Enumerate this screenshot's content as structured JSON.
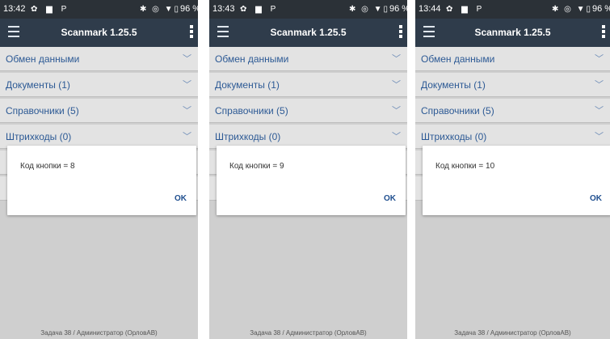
{
  "app_title": "Scanmark 1.25.5",
  "menu_items": [
    "Обмен данными",
    "Документы (1)",
    "Справочники (5)",
    "Штрихкоды (0)"
  ],
  "footer": "Задача 38 / Администратор (ОрловАВ)",
  "dialog_ok": "OK",
  "status_icons_left": "✿ ▆ P",
  "status_icons_right": "✱ ◎ ▼▯",
  "screens": [
    {
      "time": "13:42",
      "battery": "96 %",
      "dialog_message": "Код кнопки = 8"
    },
    {
      "time": "13:43",
      "battery": "96 %",
      "dialog_message": "Код кнопки = 9"
    },
    {
      "time": "13:44",
      "battery": "96 %",
      "dialog_message": "Код кнопки = 10"
    }
  ],
  "colors": {
    "statusbar": "#2b3137",
    "appbar": "#2f3c4b",
    "link_blue": "#2d5a95",
    "background": "#cfcfcf"
  }
}
